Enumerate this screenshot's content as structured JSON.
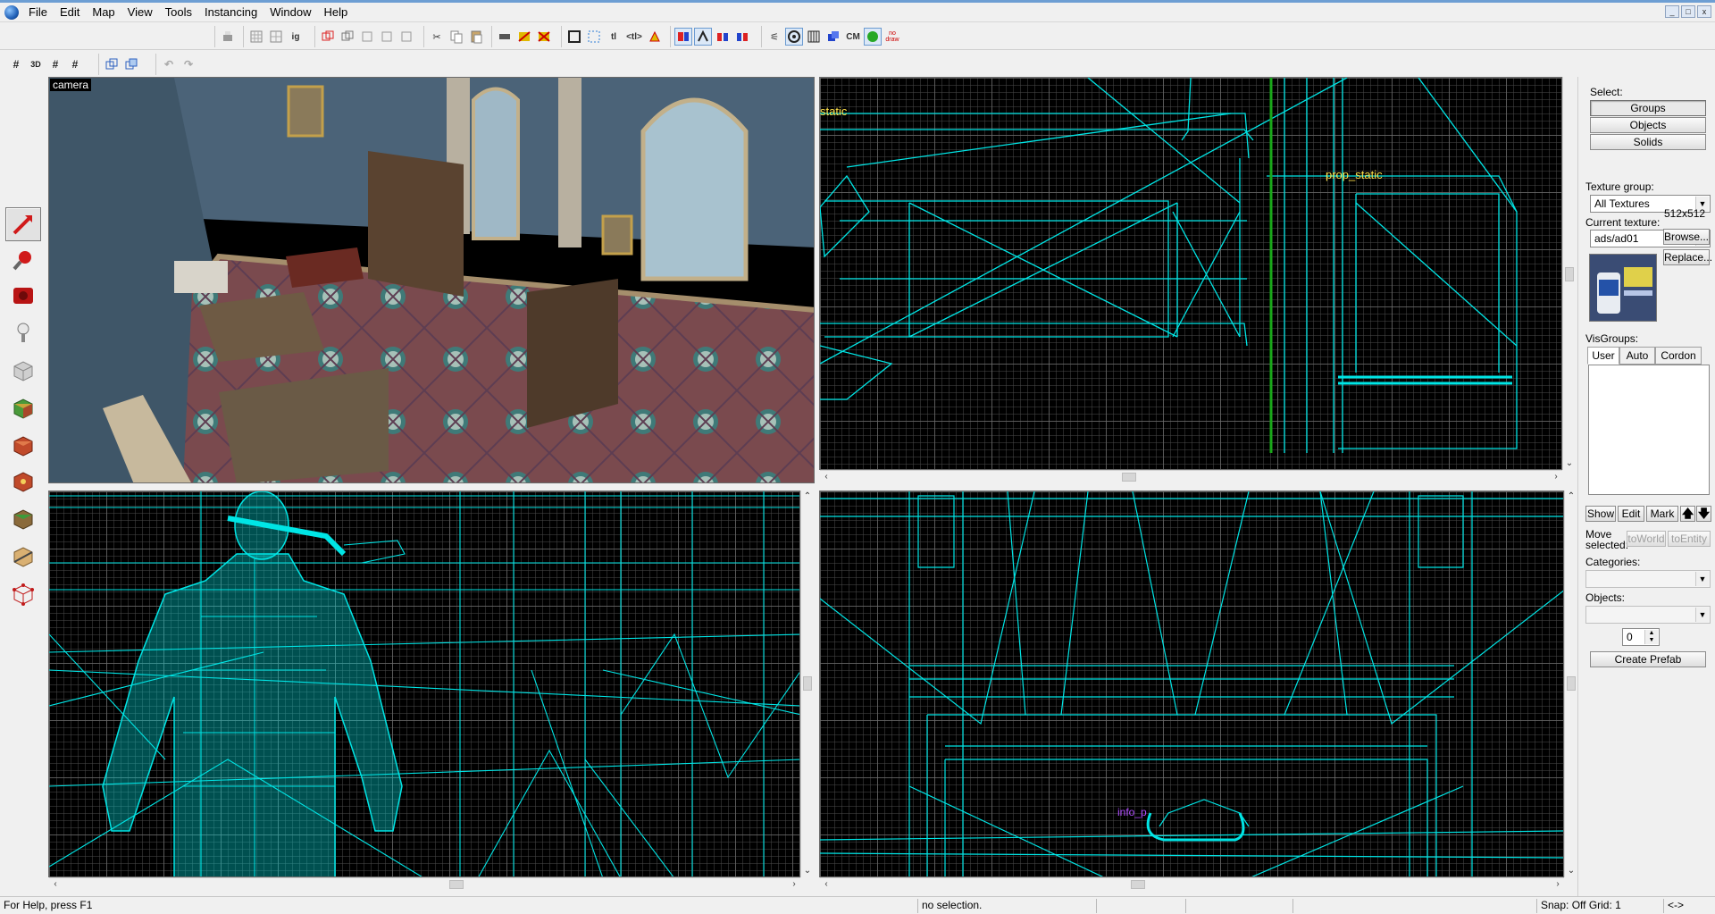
{
  "menu": [
    "File",
    "Edit",
    "Map",
    "View",
    "Tools",
    "Instancing",
    "Window",
    "Help"
  ],
  "window_controls": [
    "_",
    "□",
    "x"
  ],
  "toolbar": {
    "texts": [
      "tl",
      "<tl>",
      "CM",
      "no draw"
    ],
    "undo_icon": "undo-icon",
    "redo_icon": "redo-icon"
  },
  "toolbar2": {
    "labels": [
      "#",
      "3D",
      "#",
      "#"
    ]
  },
  "viewports": {
    "camera_label": "camera",
    "top_right_entities": [
      "static",
      "prop_static"
    ],
    "bottom_right_entity": "info_p"
  },
  "right_panel": {
    "select_label": "Select:",
    "select_buttons": [
      "Groups",
      "Objects",
      "Solids"
    ],
    "texture_group_label": "Texture group:",
    "texture_group_value": "All Textures",
    "current_texture_label": "Current texture:",
    "current_texture_value": "ads/ad01",
    "texture_size": "512x512",
    "browse_button": "Browse...",
    "replace_button": "Replace...",
    "visgroups_label": "VisGroups:",
    "vis_tabs": [
      "User",
      "Auto",
      "Cordon"
    ],
    "vis_buttons": [
      "Show",
      "Edit",
      "Mark"
    ],
    "up_icon": "up-arrow-icon",
    "down_icon": "down-arrow-icon",
    "move_selected_label": "Move selected:",
    "to_world_button": "toWorld",
    "to_entity_button": "toEntity",
    "categories_label": "Categories:",
    "objects_label": "Objects:",
    "objects_count": "0",
    "create_prefab_button": "Create Prefab"
  },
  "status": {
    "help_text": "For Help, press F1",
    "selection_text": "no selection.",
    "snap_grid": "Snap: Off Grid: 1",
    "arrows": "<->"
  },
  "colors": {
    "wireframe": "#00e5e5",
    "entity_label": "#ffe14a",
    "info_label": "#b04dff"
  }
}
